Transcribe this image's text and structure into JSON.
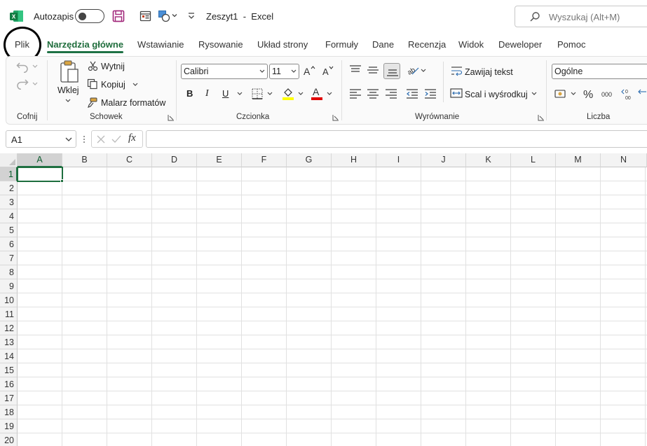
{
  "titlebar": {
    "autosave_label": "Autozapis",
    "document_title": "Zeszyt1  -  Excel",
    "search_placeholder": "Wyszukaj (Alt+M)"
  },
  "tabs": [
    "Plik",
    "Narzędzia główne",
    "Wstawianie",
    "Rysowanie",
    "Układ strony",
    "Formuły",
    "Dane",
    "Recenzja",
    "Widok",
    "Deweloper",
    "Pomoc"
  ],
  "active_tab": "Narzędzia główne",
  "ribbon": {
    "undo_group": "Cofnij",
    "clipboard": {
      "group": "Schowek",
      "paste": "Wklej",
      "cut": "Wytnij",
      "copy": "Kopiuj",
      "format_painter": "Malarz formatów"
    },
    "font": {
      "group": "Czcionka",
      "name": "Calibri",
      "size": "11",
      "bold": "B",
      "italic": "I",
      "underline": "U"
    },
    "alignment": {
      "group": "Wyrównanie",
      "wrap_text": "Zawijaj tekst",
      "merge_center": "Scal i wyśrodkuj"
    },
    "number": {
      "group": "Liczba",
      "format": "Ogólne"
    }
  },
  "formula_bar": {
    "name_box": "A1",
    "fx": "fx",
    "value": ""
  },
  "grid": {
    "columns": [
      "A",
      "B",
      "C",
      "D",
      "E",
      "F",
      "G",
      "H",
      "I",
      "J",
      "K",
      "L",
      "M",
      "N"
    ],
    "rows": [
      "1",
      "2",
      "3",
      "4",
      "5",
      "6",
      "7",
      "8",
      "9",
      "10",
      "11",
      "12",
      "13",
      "14",
      "15",
      "16",
      "17",
      "18",
      "19",
      "20"
    ],
    "selected_cell": "A1"
  },
  "colors": {
    "accent": "#1e7145",
    "font_highlight": "#ffff00",
    "font_color": "#e00000"
  }
}
